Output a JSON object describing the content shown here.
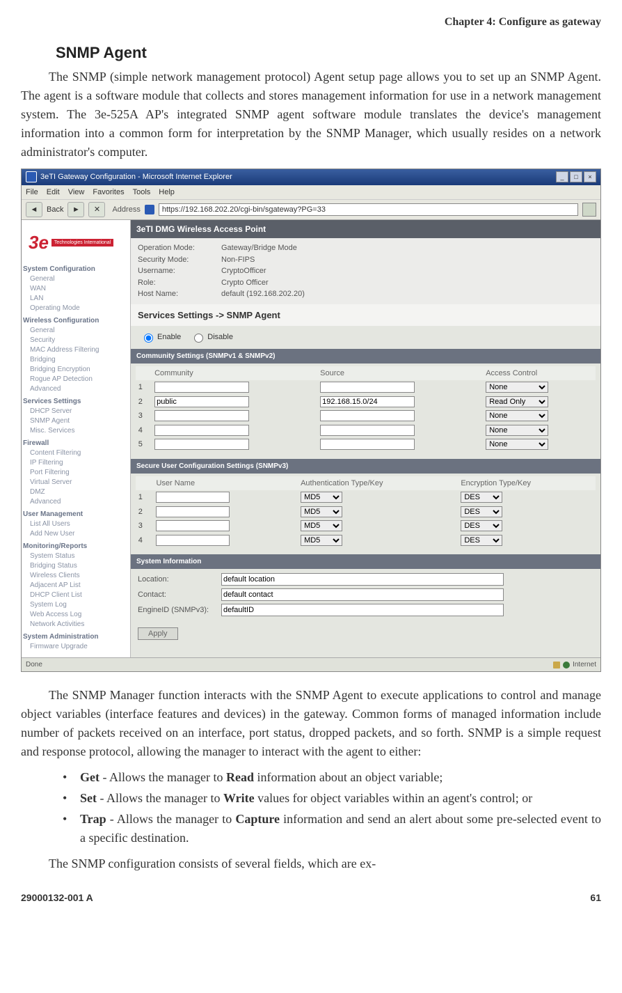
{
  "chapter_header": "Chapter 4: Configure as gateway",
  "heading": "SNMP Agent",
  "para1": "The SNMP (simple network management protocol) Agent setup page allows you to set up an SNMP Agent. The agent is a software module that collects and stores management information for use in a network management system. The 3e-525A AP's integrated SNMP agent software module translates the device's management information into a common form for interpretation by the SNMP Manager, which usually resides on a network administrator's computer.",
  "para2": "The SNMP Manager function interacts with the SNMP Agent to execute applications to control and manage object variables (interface features and devices) in the gateway. Common forms of managed information include number of packets received on an interface, port status, dropped packets, and so forth. SNMP is a simple request and response protocol, allowing the manager to interact with the agent to either:",
  "bullets": [
    {
      "b": "Get",
      "rest": " - Allows the manager to ",
      "b2": "Read",
      "rest2": " information about an object variable;"
    },
    {
      "b": "Set",
      "rest": " - Allows the manager to ",
      "b2": "Write",
      "rest2": " values for object variables within an agent's control; or"
    },
    {
      "b": "Trap",
      "rest": " - Allows the manager to ",
      "b2": "Capture",
      "rest2": "  information and send an alert about some pre-selected event to a specific destination."
    }
  ],
  "para3": "The SNMP configuration consists of several fields, which are ex-",
  "footer_left": "29000132-001 A",
  "footer_right": "61",
  "app": {
    "title": "3eTI Gateway Configuration - Microsoft Internet Explorer",
    "menus": [
      "File",
      "Edit",
      "View",
      "Favorites",
      "Tools",
      "Help"
    ],
    "address_label": "Address",
    "address_value": "https://192.168.202.20/cgi-bin/sgateway?PG=33",
    "banner": "3eTI DMG Wireless Access Point",
    "info": [
      {
        "lbl": "Operation Mode:",
        "val": "Gateway/Bridge Mode"
      },
      {
        "lbl": "Security Mode:",
        "val": "Non-FIPS"
      },
      {
        "lbl": "Username:",
        "val": "CryptoOfficer"
      },
      {
        "lbl": "Role:",
        "val": "Crypto Officer"
      },
      {
        "lbl": "Host Name:",
        "val": "default (192.168.202.20)"
      }
    ],
    "section_header": "Services Settings -> SNMP Agent",
    "enable_label": "Enable",
    "disable_label": "Disable",
    "comm_banner": "Community Settings (SNMPv1 & SNMPv2)",
    "comm_headers": [
      "Community",
      "Source",
      "Access Control"
    ],
    "comm_rows": [
      {
        "n": "1",
        "community": "",
        "source": "",
        "access": "None"
      },
      {
        "n": "2",
        "community": "public",
        "source": "192.168.15.0/24",
        "access": "Read Only"
      },
      {
        "n": "3",
        "community": "",
        "source": "",
        "access": "None"
      },
      {
        "n": "4",
        "community": "",
        "source": "",
        "access": "None"
      },
      {
        "n": "5",
        "community": "",
        "source": "",
        "access": "None"
      }
    ],
    "user_banner": "Secure User Configuration Settings (SNMPv3)",
    "user_headers": [
      "User Name",
      "Authentication Type/Key",
      "Encryption Type/Key"
    ],
    "user_rows": [
      {
        "n": "1",
        "auth": "MD5",
        "enc": "DES"
      },
      {
        "n": "2",
        "auth": "MD5",
        "enc": "DES"
      },
      {
        "n": "3",
        "auth": "MD5",
        "enc": "DES"
      },
      {
        "n": "4",
        "auth": "MD5",
        "enc": "DES"
      }
    ],
    "sysinfo_banner": "System Information",
    "sysinfo": [
      {
        "lbl": "Location:",
        "val": "default location"
      },
      {
        "lbl": "Contact:",
        "val": "default contact"
      },
      {
        "lbl": "EngineID (SNMPv3):",
        "val": "defaultID"
      }
    ],
    "apply": "Apply",
    "status_left": "Done",
    "status_right": "Internet",
    "sidebar": {
      "groups": [
        {
          "title": "System Configuration",
          "items": [
            "General",
            "WAN",
            "LAN",
            "Operating Mode"
          ]
        },
        {
          "title": "Wireless Configuration",
          "items": [
            "General",
            "Security",
            "MAC Address Filtering",
            "Bridging",
            "Bridging Encryption",
            "Rogue AP Detection",
            "Advanced"
          ]
        },
        {
          "title": "Services Settings",
          "items": [
            "DHCP Server",
            "SNMP Agent",
            "Misc. Services"
          ]
        },
        {
          "title": "Firewall",
          "items": [
            "Content Filtering",
            "IP Filtering",
            "Port Filtering",
            "Virtual Server",
            "DMZ",
            "Advanced"
          ]
        },
        {
          "title": "User Management",
          "items": [
            "List All Users",
            "Add New User"
          ]
        },
        {
          "title": "Monitoring/Reports",
          "items": [
            "System Status",
            "Bridging Status",
            "Wireless Clients",
            "Adjacent AP List",
            "DHCP Client List",
            "System Log",
            "Web Access Log",
            "Network Activities"
          ]
        },
        {
          "title": "System Administration",
          "items": [
            "Firmware Upgrade"
          ]
        }
      ]
    },
    "logo_text": "3e",
    "logo_tag": "Technologies International"
  }
}
